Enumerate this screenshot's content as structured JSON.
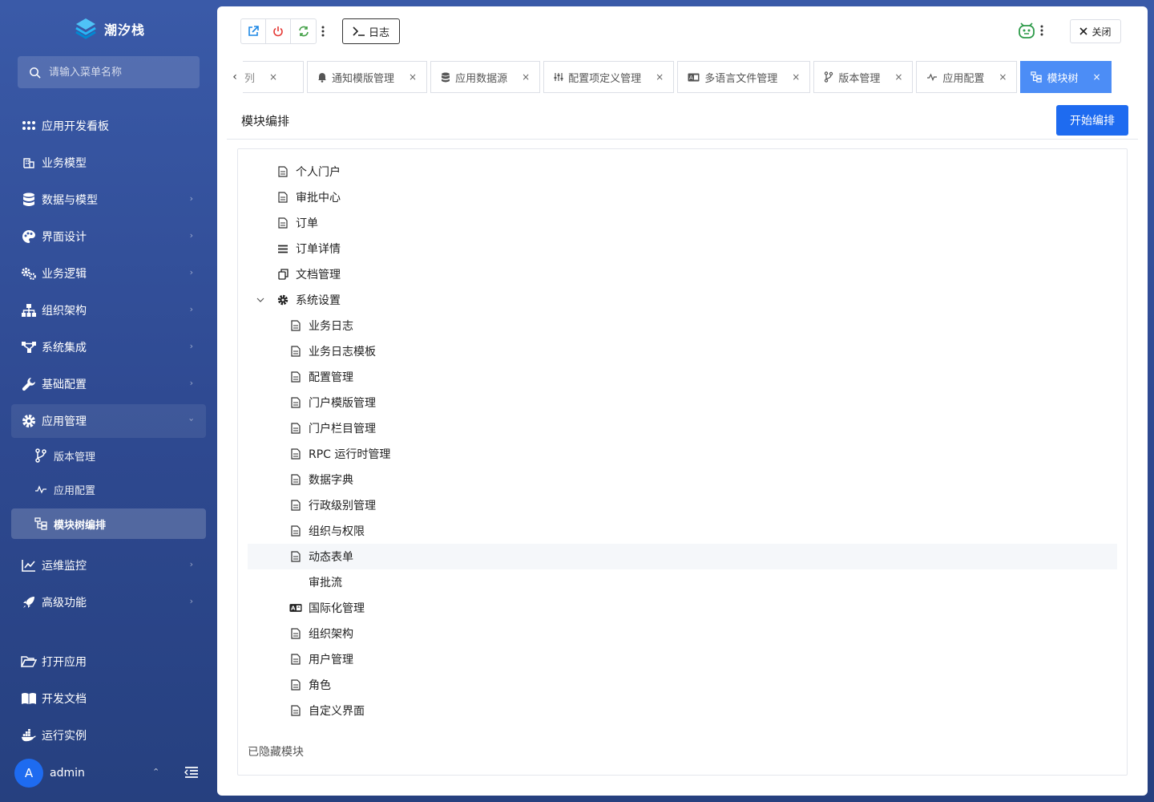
{
  "brand": {
    "name": "潮汐栈"
  },
  "search": {
    "placeholder": "请输入菜单名称"
  },
  "sidebar": {
    "items": [
      {
        "label": "应用开发看板"
      },
      {
        "label": "业务模型"
      },
      {
        "label": "数据与模型"
      },
      {
        "label": "界面设计"
      },
      {
        "label": "业务逻辑"
      },
      {
        "label": "组织架构"
      },
      {
        "label": "系统集成"
      },
      {
        "label": "基础配置"
      },
      {
        "label": "应用管理"
      },
      {
        "label": "运维监控"
      },
      {
        "label": "高级功能"
      },
      {
        "label": "打开应用"
      },
      {
        "label": "开发文档"
      },
      {
        "label": "运行实例"
      }
    ],
    "sub_items": [
      {
        "label": "版本管理"
      },
      {
        "label": "应用配置"
      },
      {
        "label": "模块树编排"
      }
    ]
  },
  "user": {
    "initial": "A",
    "name": "admin"
  },
  "toolbar": {
    "log_label": "日志",
    "close_label": "关闭"
  },
  "tabs": [
    {
      "label": "列"
    },
    {
      "label": "通知模版管理"
    },
    {
      "label": "应用数据源"
    },
    {
      "label": "配置项定义管理"
    },
    {
      "label": "多语言文件管理"
    },
    {
      "label": "版本管理"
    },
    {
      "label": "应用配置"
    },
    {
      "label": "模块树"
    }
  ],
  "page": {
    "title": "模块编排",
    "start_button": "开始编排"
  },
  "tree": {
    "nodes": [
      {
        "label": "个人门户"
      },
      {
        "label": "审批中心"
      },
      {
        "label": "订单"
      },
      {
        "label": "订单详情"
      },
      {
        "label": "文档管理"
      },
      {
        "label": "系统设置"
      },
      {
        "label": "业务日志"
      },
      {
        "label": "业务日志模板"
      },
      {
        "label": "配置管理"
      },
      {
        "label": "门户模版管理"
      },
      {
        "label": "门户栏目管理"
      },
      {
        "label": "RPC 运行时管理"
      },
      {
        "label": "数据字典"
      },
      {
        "label": "行政级别管理"
      },
      {
        "label": "组织与权限"
      },
      {
        "label": "动态表单"
      },
      {
        "label": "审批流"
      },
      {
        "label": "国际化管理"
      },
      {
        "label": "组织架构"
      },
      {
        "label": "用户管理"
      },
      {
        "label": "角色"
      },
      {
        "label": "自定义界面"
      }
    ],
    "hidden_section_title": "已隐藏模块"
  },
  "colors": {
    "primary": "#1e6bf0",
    "active_tab": "#4c8df6",
    "sidebar_bg": "#3a5aa8"
  }
}
